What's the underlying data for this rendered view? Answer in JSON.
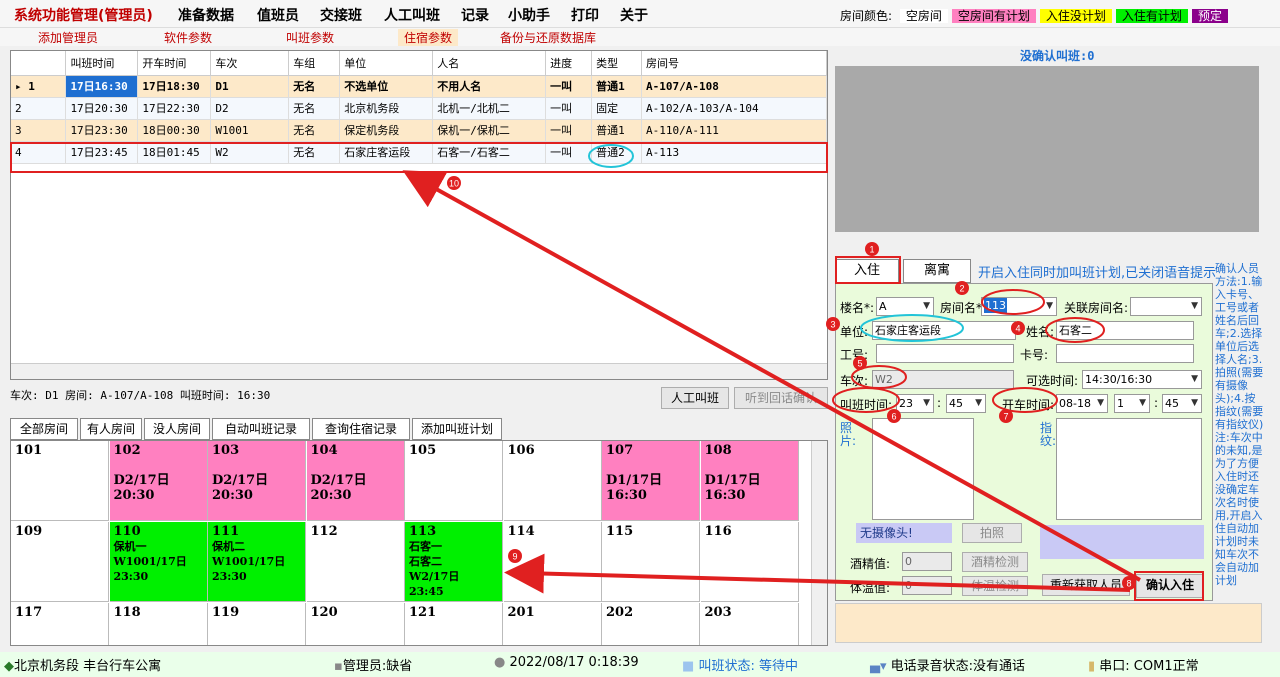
{
  "menu": [
    "系统功能管理(管理员)",
    "准备数据",
    "值班员",
    "交接班",
    "人工叫班",
    "记录",
    "小助手",
    "打印",
    "关于"
  ],
  "legend": {
    "label": "房间颜色:",
    "items": [
      {
        "text": "空房间",
        "bg": "#ffffff",
        "color": "#000000"
      },
      {
        "text": "空房间有计划",
        "bg": "#ff80c0",
        "color": "#000000"
      },
      {
        "text": "入住没计划",
        "bg": "#ffff00",
        "color": "#000000"
      },
      {
        "text": "入住有计划",
        "bg": "#00f000",
        "color": "#000000"
      },
      {
        "text": "预定",
        "bg": "#8b008b",
        "color": "#ffffff"
      }
    ]
  },
  "submenu": [
    "添加管理员",
    "软件参数",
    "叫班参数",
    "住宿参数",
    "备份与还原数据库"
  ],
  "grid": {
    "columns": [
      "",
      "叫班时间",
      "开车时间",
      "车次",
      "车组",
      "单位",
      "人名",
      "进度",
      "类型",
      "房间号"
    ],
    "rows": [
      [
        "▸ 1",
        "17日16:30",
        "17日18:30",
        "D1",
        "无名",
        "不选单位",
        "不用人名",
        "一叫",
        "普通1",
        "A-107/A-108"
      ],
      [
        "2",
        "17日20:30",
        "17日22:30",
        "D2",
        "无名",
        "北京机务段",
        "北机一/北机二",
        "一叫",
        "固定",
        "A-102/A-103/A-104"
      ],
      [
        "3",
        "17日23:30",
        "18日00:30",
        "W1001",
        "无名",
        "保定机务段",
        "保机一/保机二",
        "一叫",
        "普通1",
        "A-110/A-111"
      ],
      [
        "4",
        "17日23:45",
        "18日01:45",
        "W2",
        "无名",
        "石家庄客运段",
        "石客一/石客二",
        "一叫",
        "普通2",
        "A-113"
      ]
    ]
  },
  "info": "车次: D1 房间: A-107/A-108  叫班时间: 16:30",
  "buttons": {
    "manual_call": "人工叫班",
    "heard_confirm": "听到回话确认",
    "photo": "拍照",
    "alcohol_test": "酒精检测",
    "temp_test": "体温检测",
    "reread": "重新获取人员",
    "confirm_checkin": "确认入住"
  },
  "tabs": [
    "全部房间",
    "有人房间",
    "没人房间",
    "自动叫班记录",
    "查询住宿记录",
    "添加叫班计划"
  ],
  "rooms": [
    {
      "no": "101",
      "lines": [],
      "color": "white"
    },
    {
      "no": "102",
      "lines": [
        "",
        "D2/17日",
        "20:30"
      ],
      "color": "pink"
    },
    {
      "no": "103",
      "lines": [
        "",
        "D2/17日",
        "20:30"
      ],
      "color": "pink"
    },
    {
      "no": "104",
      "lines": [
        "",
        "D2/17日",
        "20:30"
      ],
      "color": "pink"
    },
    {
      "no": "105",
      "lines": [],
      "color": "white"
    },
    {
      "no": "106",
      "lines": [],
      "color": "white"
    },
    {
      "no": "107",
      "lines": [
        "",
        "D1/17日",
        "16:30"
      ],
      "color": "pink"
    },
    {
      "no": "108",
      "lines": [
        "",
        "D1/17日",
        "16:30"
      ],
      "color": "pink"
    },
    {
      "no": "109",
      "lines": [],
      "color": "white"
    },
    {
      "no": "110",
      "lines": [
        "保机一",
        "W1001/17日",
        "23:30"
      ],
      "color": "green"
    },
    {
      "no": "111",
      "lines": [
        "保机二",
        "W1001/17日",
        "23:30"
      ],
      "color": "green"
    },
    {
      "no": "112",
      "lines": [],
      "color": "white"
    },
    {
      "no": "113",
      "lines": [
        "石客一",
        "石客二",
        "W2/17日",
        "23:45"
      ],
      "color": "green"
    },
    {
      "no": "114",
      "lines": [],
      "color": "white"
    },
    {
      "no": "115",
      "lines": [],
      "color": "white"
    },
    {
      "no": "116",
      "lines": [],
      "color": "white"
    },
    {
      "no": "117",
      "lines": [],
      "color": "white"
    },
    {
      "no": "118",
      "lines": [],
      "color": "white"
    },
    {
      "no": "119",
      "lines": [],
      "color": "white"
    },
    {
      "no": "120",
      "lines": [],
      "color": "white"
    },
    {
      "no": "121",
      "lines": [],
      "color": "white"
    },
    {
      "no": "201",
      "lines": [],
      "color": "white"
    },
    {
      "no": "202",
      "lines": [],
      "color": "white"
    },
    {
      "no": "203",
      "lines": [],
      "color": "white"
    }
  ],
  "confirm_title": "没确认叫班:0",
  "form_tabs": {
    "checkin": "入住",
    "checkout": "离寓"
  },
  "hint": "开启入住同时加叫班计划,已关闭语音提示",
  "form": {
    "building_label": "楼名*:",
    "building_value": "A",
    "room_label": "房间名*:",
    "room_value": "113",
    "related_label": "关联房间名:",
    "related_value": "",
    "unit_label": "单位:",
    "unit_value": "石家庄客运段",
    "name_label": "姓名:",
    "name_value": "石客二",
    "workno_label": "工号:",
    "workno_value": "",
    "card_label": "卡号:",
    "card_value": "",
    "train_label": "车次:",
    "train_value": "W2",
    "avail_label": "可选时间:",
    "avail_value": "14:30/16:30",
    "call_label": "叫班时间:",
    "call_h": "23",
    "call_m": "45",
    "colon": ":",
    "depart_label": "开车时间:",
    "depart_date": "08-18",
    "depart_h": "1",
    "depart_m": "45",
    "photo_label": "照片:",
    "finger_label": "指纹:",
    "no_camera": "无摄像头!",
    "alcohol_label": "酒精值:",
    "alcohol_value": "0",
    "temp_label": "体温值:",
    "temp_value": "0"
  },
  "side_info": "确认人员方法:1.输入卡号、工号或者姓名后回车;2.选择单位后选择人名;3.拍照(需要有摄像头);4.按指纹(需要有指纹仪)注:车次中的未知,是为了方便入住时还没确定车次名时使用,开启入住自动加计划时未知车次不会自动加计划",
  "status": {
    "unit": "北京机务段 丰台行车公寓",
    "admin": "管理员:缺省",
    "datetime": "2022/08/17 0:18:39",
    "call_state": "叫班状态: 等待中",
    "phone": "电话录音状态:没有通话",
    "serial": "串口: COM1正常"
  },
  "markers": [
    "1",
    "2",
    "3",
    "4",
    "5",
    "6",
    "7",
    "8",
    "9",
    "10"
  ],
  "colors": {
    "annotation_red": "#e02020",
    "annotation_cyan": "#22c4d8",
    "room_pink": "#ff80c0",
    "room_green": "#00f000",
    "accent_blue": "#1f6fd1"
  }
}
